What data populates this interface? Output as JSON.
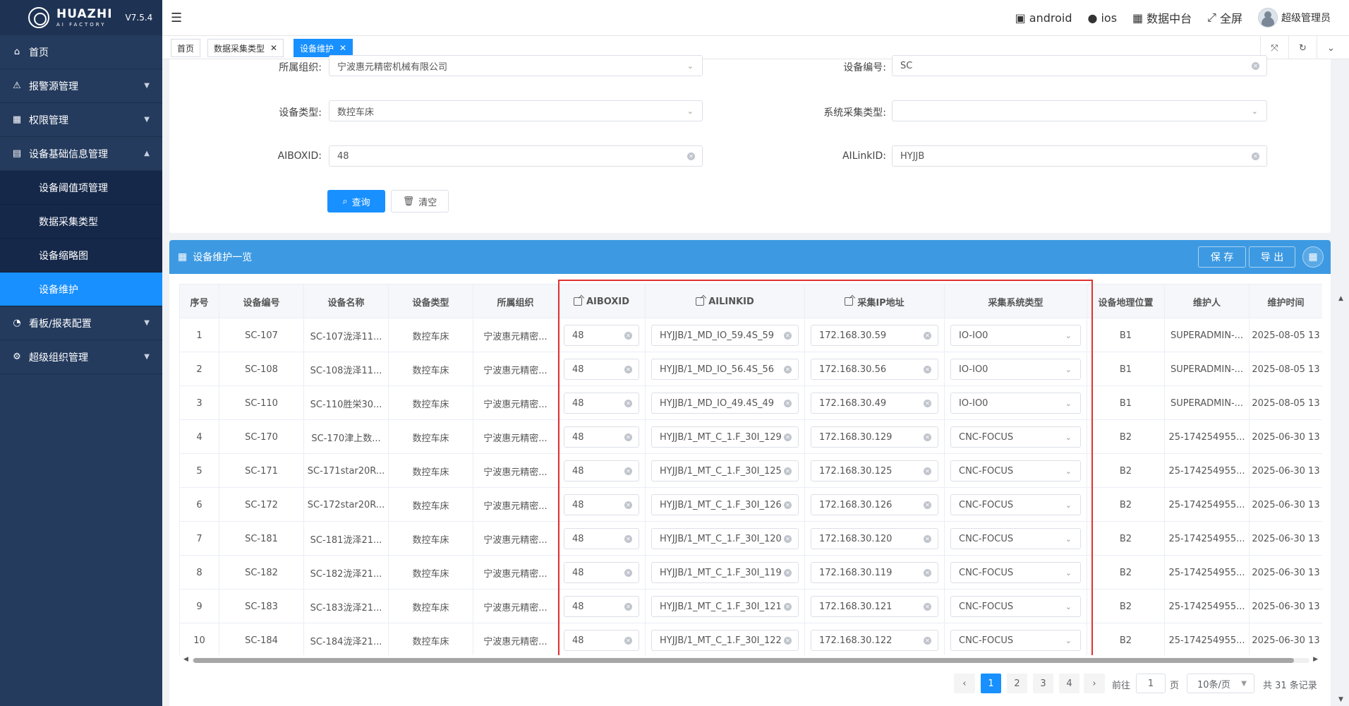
{
  "app": {
    "brand": "HUAZHI",
    "brand_sub": "AI FACTORY",
    "version": "V7.5.4"
  },
  "sidebar": {
    "items": [
      {
        "label": "首页",
        "icon": "home-icon"
      },
      {
        "label": "报警源管理",
        "icon": "alert-icon"
      },
      {
        "label": "权限管理",
        "icon": "grid-icon"
      },
      {
        "label": "设备基础信息管理",
        "icon": "clipboard-icon",
        "expanded": true
      },
      {
        "label": "看板/报表配置",
        "icon": "dashboard-icon"
      },
      {
        "label": "超级组织管理",
        "icon": "gear-icon"
      }
    ],
    "subitems": [
      "设备阈值项管理",
      "数据采集类型",
      "设备缩略图",
      "设备维护"
    ],
    "active_subitem": "设备维护"
  },
  "header": {
    "android": "android",
    "ios": "ios",
    "data_center": "数据中台",
    "fullscreen": "全屏",
    "user": "超级管理员"
  },
  "tabs": [
    {
      "label": "首页"
    },
    {
      "label": "数据采集类型"
    },
    {
      "label": "设备维护"
    }
  ],
  "filter": {
    "org_label": "所属组织:",
    "org_value": "宁波惠元精密机械有限公司",
    "code_label": "设备编号:",
    "code_value": "SC",
    "type_label": "设备类型:",
    "type_value": "数控车床",
    "syscol_label": "系统采集类型:",
    "syscol_value": "",
    "aibox_label": "AIBOXID:",
    "aibox_value": "48",
    "ailink_label": "AILinkID:",
    "ailink_value": "HYJJB",
    "query_btn": "查询",
    "clear_btn": "清空"
  },
  "list": {
    "title": "设备维护一览",
    "save_btn": "保 存",
    "export_btn": "导 出",
    "columns": [
      "序号",
      "设备编号",
      "设备名称",
      "设备类型",
      "所属组织",
      "AIBOXID",
      "AILINKID",
      "采集IP地址",
      "采集系统类型",
      "设备地理位置",
      "维护人",
      "维护时间"
    ],
    "rows": [
      {
        "no": "1",
        "code": "SC-107",
        "name": "SC-107泷泽11...",
        "type": "数控车床",
        "org": "宁波惠元精密...",
        "aibox": "48",
        "ailink": "HYJJB/1_MD_IO_59.4S_59",
        "ip": "172.168.30.59",
        "sys": "IO-IO0",
        "loc": "B1",
        "user": "SUPERADMIN-...",
        "time": "2025-08-05 13"
      },
      {
        "no": "2",
        "code": "SC-108",
        "name": "SC-108泷泽11...",
        "type": "数控车床",
        "org": "宁波惠元精密...",
        "aibox": "48",
        "ailink": "HYJJB/1_MD_IO_56.4S_56",
        "ip": "172.168.30.56",
        "sys": "IO-IO0",
        "loc": "B1",
        "user": "SUPERADMIN-...",
        "time": "2025-08-05 13"
      },
      {
        "no": "3",
        "code": "SC-110",
        "name": "SC-110胜栄30...",
        "type": "数控车床",
        "org": "宁波惠元精密...",
        "aibox": "48",
        "ailink": "HYJJB/1_MD_IO_49.4S_49",
        "ip": "172.168.30.49",
        "sys": "IO-IO0",
        "loc": "B1",
        "user": "SUPERADMIN-...",
        "time": "2025-08-05 13"
      },
      {
        "no": "4",
        "code": "SC-170",
        "name": "SC-170津上数...",
        "type": "数控车床",
        "org": "宁波惠元精密...",
        "aibox": "48",
        "ailink": "HYJJB/1_MT_C_1.F_30I_129",
        "ip": "172.168.30.129",
        "sys": "CNC-FOCUS",
        "loc": "B2",
        "user": "25-174254955...",
        "time": "2025-06-30 13"
      },
      {
        "no": "5",
        "code": "SC-171",
        "name": "SC-171star20R...",
        "type": "数控车床",
        "org": "宁波惠元精密...",
        "aibox": "48",
        "ailink": "HYJJB/1_MT_C_1.F_30I_125",
        "ip": "172.168.30.125",
        "sys": "CNC-FOCUS",
        "loc": "B2",
        "user": "25-174254955...",
        "time": "2025-06-30 13"
      },
      {
        "no": "6",
        "code": "SC-172",
        "name": "SC-172star20R...",
        "type": "数控车床",
        "org": "宁波惠元精密...",
        "aibox": "48",
        "ailink": "HYJJB/1_MT_C_1.F_30I_126",
        "ip": "172.168.30.126",
        "sys": "CNC-FOCUS",
        "loc": "B2",
        "user": "25-174254955...",
        "time": "2025-06-30 13"
      },
      {
        "no": "7",
        "code": "SC-181",
        "name": "SC-181泷泽21...",
        "type": "数控车床",
        "org": "宁波惠元精密...",
        "aibox": "48",
        "ailink": "HYJJB/1_MT_C_1.F_30I_120",
        "ip": "172.168.30.120",
        "sys": "CNC-FOCUS",
        "loc": "B2",
        "user": "25-174254955...",
        "time": "2025-06-30 13"
      },
      {
        "no": "8",
        "code": "SC-182",
        "name": "SC-182泷泽21...",
        "type": "数控车床",
        "org": "宁波惠元精密...",
        "aibox": "48",
        "ailink": "HYJJB/1_MT_C_1.F_30I_119",
        "ip": "172.168.30.119",
        "sys": "CNC-FOCUS",
        "loc": "B2",
        "user": "25-174254955...",
        "time": "2025-06-30 13"
      },
      {
        "no": "9",
        "code": "SC-183",
        "name": "SC-183泷泽21...",
        "type": "数控车床",
        "org": "宁波惠元精密...",
        "aibox": "48",
        "ailink": "HYJJB/1_MT_C_1.F_30I_121",
        "ip": "172.168.30.121",
        "sys": "CNC-FOCUS",
        "loc": "B2",
        "user": "25-174254955...",
        "time": "2025-06-30 13"
      },
      {
        "no": "10",
        "code": "SC-184",
        "name": "SC-184泷泽21...",
        "type": "数控车床",
        "org": "宁波惠元精密...",
        "aibox": "48",
        "ailink": "HYJJB/1_MT_C_1.F_30I_122",
        "ip": "172.168.30.122",
        "sys": "CNC-FOCUS",
        "loc": "B2",
        "user": "25-174254955...",
        "time": "2025-06-30 13"
      }
    ]
  },
  "pagination": {
    "pages": [
      "1",
      "2",
      "3",
      "4"
    ],
    "current": "1",
    "goto_label": "前往",
    "goto_value": "1",
    "page_unit": "页",
    "page_size": "10条/页",
    "total": "共 31 条记录"
  },
  "colors": {
    "sidebar": "#243b5e",
    "accent": "#1890ff",
    "list_header": "#3d9ae2",
    "highlight": "#e03131"
  }
}
